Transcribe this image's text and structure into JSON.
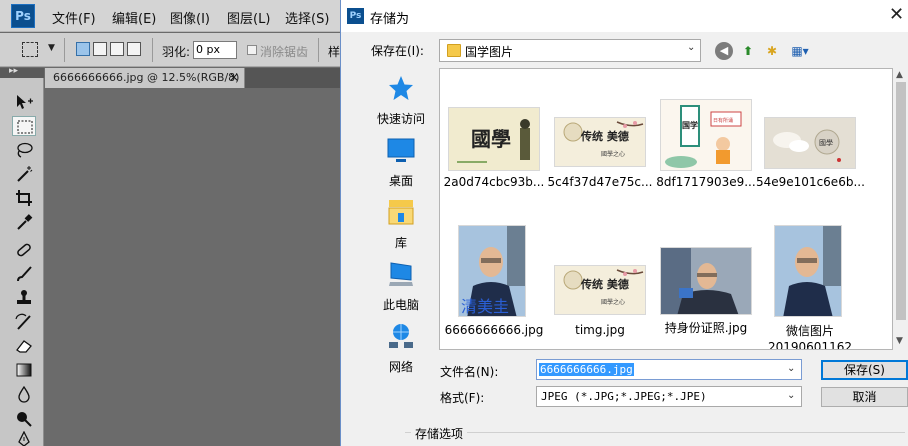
{
  "photoshop": {
    "logo": "Ps",
    "menu": [
      "文件(F)",
      "编辑(E)",
      "图像(I)",
      "图层(L)",
      "选择(S)"
    ],
    "options": {
      "feather_label": "羽化:",
      "feather_value": "0 px",
      "antialias_label": "消除锯齿",
      "style_label": "样"
    },
    "doc_tab": {
      "title": "6666666666.jpg @ 12.5%(RGB/8)",
      "close": "×"
    },
    "toolbar_grip": "▸▸"
  },
  "dialog": {
    "icon": "Ps",
    "title": "存储为",
    "close": "✕",
    "save_in_label": "保存在(I):",
    "save_in_value": "国学图片",
    "places": [
      {
        "label": "快速访问",
        "icon": "star-icon"
      },
      {
        "label": "桌面",
        "icon": "desktop-icon"
      },
      {
        "label": "库",
        "icon": "library-icon"
      },
      {
        "label": "此电脑",
        "icon": "computer-icon"
      },
      {
        "label": "网络",
        "icon": "network-icon"
      }
    ],
    "files": [
      {
        "name": "2a0d74cbc93b...",
        "art": "guoxue-art"
      },
      {
        "name": "5c4f37d47e75c...",
        "art": "chuantong-art"
      },
      {
        "name": "8df1717903e9...",
        "art": "kids-art"
      },
      {
        "name": "54e9e101c6e6b...",
        "art": "cloud-art"
      },
      {
        "name": "6666666666.jpg",
        "art": "portrait-art"
      },
      {
        "name": "timg.jpg",
        "art": "chuantong-art"
      },
      {
        "name": "持身份证照.jpg",
        "art": "id-photo-art"
      },
      {
        "name": "微信图片\n20190601162",
        "art": "portrait-art"
      }
    ],
    "watermark_text": "清美圭",
    "art_text": {
      "guoxue": "國學",
      "chuantong": "传统 美德",
      "chuantong_sub": "國學之心",
      "kids": "国学",
      "kids_sign": "日有所诵",
      "cloud": "國學"
    },
    "filename_label": "文件名(N):",
    "filename_value": "6666666666.jpg",
    "format_label": "格式(F):",
    "format_value": "JPEG (*.JPG;*.JPEG;*.JPE)",
    "save_button": "保存(S)",
    "cancel_button": "取消",
    "options_group": "存储选项"
  }
}
